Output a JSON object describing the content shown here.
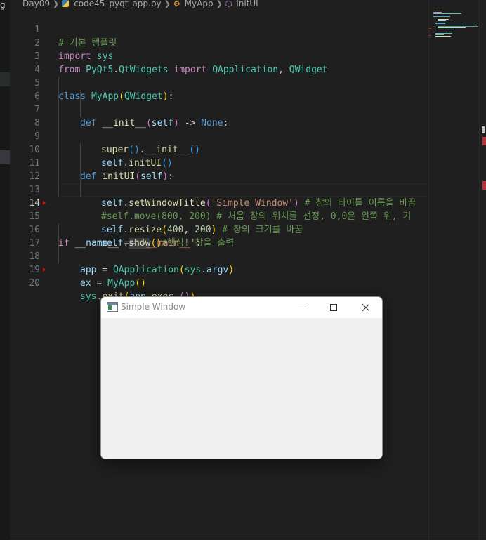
{
  "left_edge_char": "g",
  "breadcrumb": {
    "folder": "Day09",
    "file": "code45_pyqt_app.py",
    "class_name": "MyApp",
    "method_name": "initUI"
  },
  "editor": {
    "current_line": 14,
    "lines": [
      {
        "num": "1"
      },
      {
        "num": "2"
      },
      {
        "num": "3"
      },
      {
        "num": "4"
      },
      {
        "num": "5"
      },
      {
        "num": "6"
      },
      {
        "num": "7"
      },
      {
        "num": "8"
      },
      {
        "num": "9"
      },
      {
        "num": "10"
      },
      {
        "num": "11"
      },
      {
        "num": "12"
      },
      {
        "num": "13"
      },
      {
        "num": "14"
      },
      {
        "num": "15"
      },
      {
        "num": "16"
      },
      {
        "num": "17"
      },
      {
        "num": "18"
      },
      {
        "num": "19"
      },
      {
        "num": "20"
      }
    ],
    "tokens": {
      "l1_comment": "# 기본 템플릿",
      "l2_import": "import",
      "l2_mod": "sys",
      "l3_from": "from",
      "l3_pkg": "PyQt5",
      "l3_dot": ".",
      "l3_sub": "QtWidgets",
      "l3_import": "import",
      "l3_c1": "QApplication",
      "l3_comma": ", ",
      "l3_c2": "QWidget",
      "l5_class": "class",
      "l5_name": "MyApp",
      "l5_po": "(",
      "l5_base": "QWidget",
      "l5_pc": ")",
      "l5_colon": ":",
      "l6_def": "def",
      "l6_name": "__init__",
      "l6_po": "(",
      "l6_self": "self",
      "l6_pc": ")",
      "l6_arrow": " -> ",
      "l6_none": "None",
      "l6_colon": ":",
      "l7_super": "super",
      "l7_p1": "()",
      "l7_dot": ".",
      "l7_init": "__init__",
      "l7_p2": "()",
      "l8_self": "self",
      "l8_dot": ".",
      "l8_fn": "initUI",
      "l8_p": "()",
      "l10_def": "def",
      "l10_name": "initUI",
      "l10_po": "(",
      "l10_self": "self",
      "l10_pc": ")",
      "l10_colon": ":",
      "l11_self": "self",
      "l11_dot": ".",
      "l11_fn": "setWindowTitle",
      "l11_po": "(",
      "l11_str": "'Simple Window'",
      "l11_pc": ")",
      "l11_comment": "# 창의 타이틀 이름을 바꿈",
      "l12_comment": "#self.move(800, 200) # 처음 창의 위치를 선정, 0,0은 왼쪽 위, 기",
      "l13_self": "self",
      "l13_dot": ".",
      "l13_fn": "resize",
      "l13_po": "(",
      "l13_n1": "400",
      "l13_comma": ", ",
      "l13_n2": "200",
      "l13_pc": ")",
      "l13_comment": "# 창의 크기를 바꿈",
      "l14_self": "self",
      "l14_dot": ".",
      "l14_fn": "show",
      "l14_p": "()",
      "l14_comment": "#핵심! 창을 출력",
      "l16_if": "if",
      "l16_name": "__name__",
      "l16_eq": " == ",
      "l16_str": "'__main__'",
      "l16_colon": ":",
      "l17_var": "app",
      "l17_eq": " = ",
      "l17_cls": "QApplication",
      "l17_po": "(",
      "l17_sys": "sys",
      "l17_dot": ".",
      "l17_argv": "argv",
      "l17_pc": ")",
      "l18_var": "ex",
      "l18_eq": " = ",
      "l18_cls": "MyApp",
      "l18_p": "()",
      "l19_sys": "sys",
      "l19_dot1": ".",
      "l19_exit": "exit",
      "l19_po": "(",
      "l19_app": "app",
      "l19_dot2": ".",
      "l19_exec": "exec_",
      "l19_pi": "()",
      "l19_pc": ")"
    }
  },
  "app_window": {
    "title": "Simple Window",
    "buttons": [
      "minimize",
      "maximize",
      "close"
    ]
  },
  "colors": {
    "editor_bg": "#1f1f1f",
    "comment": "#6a9955",
    "keyword": "#569cd6",
    "control_keyword": "#c586c0",
    "function": "#dcdcaa",
    "class": "#4ec9b0",
    "string": "#ce9178",
    "variable": "#9cdcfe",
    "number": "#b5cea8",
    "window_bg": "#f0f0f0"
  }
}
